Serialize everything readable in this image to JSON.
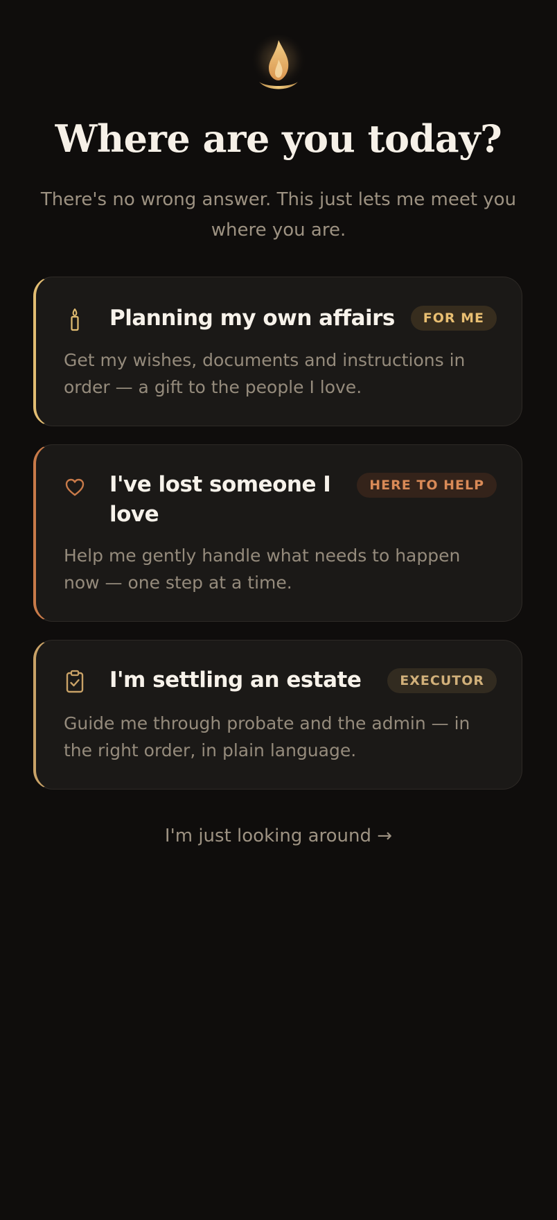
{
  "header": {
    "logo_icon": "flame-lamp-icon",
    "title": "Where are you today?",
    "subtitle": "There's no wrong answer. This just lets me meet you where you are."
  },
  "options": [
    {
      "icon": "candle-icon",
      "title": "Planning my own affairs",
      "badge": "FOR ME",
      "description": "Get my wishes, documents and instructions in order — a gift to the people I love.",
      "accent": "#e2bd72"
    },
    {
      "icon": "heart-icon",
      "title": "I've lost someone I love",
      "badge": "HERE TO HELP",
      "description": "Help me gently handle what needs to happen now — one step at a time.",
      "accent": "#c87a49"
    },
    {
      "icon": "clipboard-check-icon",
      "title": "I'm settling an estate",
      "badge": "EXECUTOR",
      "description": "Guide me through probate and the admin — in the right order, in plain language.",
      "accent": "#c9a267"
    }
  ],
  "footer": {
    "browse_link": "I'm just looking around →"
  },
  "colors": {
    "background": "#0f0d0c",
    "card": "#1b1917",
    "gold": "#e2bd72",
    "copper": "#c87a49"
  }
}
